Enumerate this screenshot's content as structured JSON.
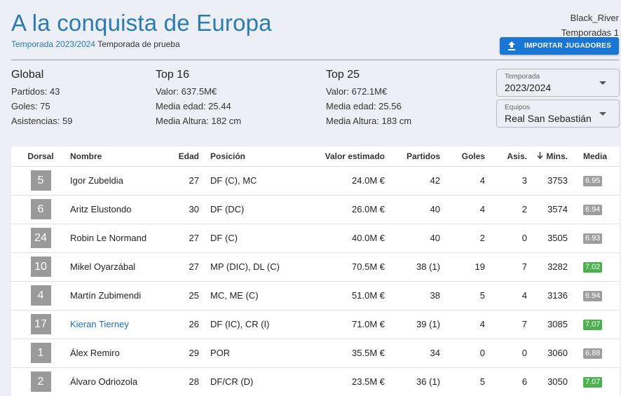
{
  "header": {
    "title": "A la conquista de Europa",
    "season": "Temporada 2023/2024",
    "mode": "Temporada de prueba",
    "username": "Black_River",
    "seasons_count": "Temporadas 1",
    "import_label": "IMPORTAR JUGADORES"
  },
  "stats": {
    "global": {
      "title": "Global",
      "partidos": "Partidos: 43",
      "goles": "Goles: 75",
      "asistencias": "Asistencias: 59"
    },
    "top16": {
      "title": "Top 16",
      "valor": "Valor: 637.5M€",
      "edad": "Media edad: 25.44",
      "altura": "Media Altura: 182 cm"
    },
    "top25": {
      "title": "Top 25",
      "valor": "Valor: 672.1M€",
      "edad": "Media edad: 25.56",
      "altura": "Media Altura: 183 cm"
    }
  },
  "filters": {
    "season_label": "Temporada",
    "season_value": "2023/2024",
    "team_label": "Equipos",
    "team_value": "Real San Sebastián"
  },
  "table": {
    "headers": [
      "Dorsal",
      "Nombre",
      "Edad",
      "Posición",
      "Valor estimado",
      "Partidos",
      "Goles",
      "Asis.",
      "Mins.",
      "Media"
    ],
    "rows": [
      {
        "dorsal": "5",
        "nombre": "Igor Zubeldia",
        "edad": "27",
        "posicion": "DF (C), MC",
        "valor": "24.0M €",
        "partidos": "42",
        "goles": "4",
        "asis": "3",
        "mins": "3753",
        "media": "6.95",
        "media_color": "#9e9e9e",
        "link": false
      },
      {
        "dorsal": "6",
        "nombre": "Aritz Elustondo",
        "edad": "30",
        "posicion": "DF (DC)",
        "valor": "26.0M €",
        "partidos": "40",
        "goles": "4",
        "asis": "2",
        "mins": "3574",
        "media": "6.94",
        "media_color": "#9e9e9e",
        "link": false
      },
      {
        "dorsal": "24",
        "nombre": "Robin Le Normand",
        "edad": "27",
        "posicion": "DF (C)",
        "valor": "40.0M €",
        "partidos": "40",
        "goles": "2",
        "asis": "0",
        "mins": "3505",
        "media": "6.93",
        "media_color": "#9e9e9e",
        "link": false
      },
      {
        "dorsal": "10",
        "nombre": "Mikel Oyarzábal",
        "edad": "27",
        "posicion": "MP (DIC), DL (C)",
        "valor": "70.5M €",
        "partidos": "38 (1)",
        "goles": "19",
        "asis": "7",
        "mins": "3282",
        "media": "7.02",
        "media_color": "#4caf50",
        "link": false
      },
      {
        "dorsal": "4",
        "nombre": "Martín Zubimendi",
        "edad": "25",
        "posicion": "MC, ME (C)",
        "valor": "51.0M €",
        "partidos": "38",
        "goles": "5",
        "asis": "4",
        "mins": "3136",
        "media": "6.94",
        "media_color": "#9e9e9e",
        "link": false
      },
      {
        "dorsal": "17",
        "nombre": "Kieran Tierney",
        "edad": "26",
        "posicion": "DF (IC), CR (I)",
        "valor": "71.0M €",
        "partidos": "39 (1)",
        "goles": "4",
        "asis": "7",
        "mins": "3085",
        "media": "7.07",
        "media_color": "#4caf50",
        "link": true
      },
      {
        "dorsal": "1",
        "nombre": "Álex Remiro",
        "edad": "29",
        "posicion": "POR",
        "valor": "35.5M €",
        "partidos": "34",
        "goles": "0",
        "asis": "0",
        "mins": "3060",
        "media": "6.88",
        "media_color": "#9e9e9e",
        "link": false
      },
      {
        "dorsal": "2",
        "nombre": "Álvaro Odriozola",
        "edad": "28",
        "posicion": "DF/CR (D)",
        "valor": "23.5M €",
        "partidos": "36 (1)",
        "goles": "5",
        "asis": "6",
        "mins": "3050",
        "media": "7.07",
        "media_color": "#4caf50",
        "link": false
      }
    ]
  }
}
